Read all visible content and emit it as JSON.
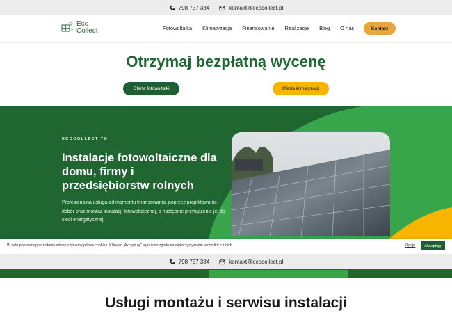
{
  "topbar": {
    "phone": "798 757 384",
    "email": "kontakt@ecocollect.pl",
    "phone_icon": "phone-icon",
    "email_icon": "mail-icon"
  },
  "header": {
    "logo_line1": "Eco",
    "logo_line2": "Collect",
    "nav": [
      "Fotowoltaika",
      "Klimatyzacja",
      "Finansowanie",
      "Realizacje",
      "Blog",
      "O nas"
    ],
    "cta": "Kontakt"
  },
  "quote": {
    "title": "Otrzymaj bezpłatną wycenę",
    "btn_pv": "Oferta fotowoltaiki",
    "btn_ac": "Oferta klimatyzacji"
  },
  "hero": {
    "eyebrow": "ECOCOLLECT TO",
    "title": "Instalacje fotowoltaiczne dla domu, firmy i przedsiębiorstw rolnych",
    "description": "Profesjonalna usługa od momentu finansowania, poprzez projektowanie, dobór oraz montaż instalacji fotowoltaicznej, a następnie przyłączenie jej do sieci energetycznej."
  },
  "cookie": {
    "text": "W celu poprawnego działania strony używamy plików cookies. Klikając „Akceptuję” wyrażasz zgodę na wykorzystywanie wszystkich z nich.",
    "options": "Opcje",
    "accept": "Akceptuję"
  },
  "sticky_bar": {
    "phone": "798 757 384",
    "email": "kontakt@ecocollect.pl"
  },
  "services": {
    "title": "Usługi montażu i serwisu instalacji"
  },
  "colors": {
    "brand_green": "#1f6630",
    "accent_orange": "#e8a53a",
    "accent_yellow": "#f7b500",
    "light_green": "#3aa84e"
  }
}
